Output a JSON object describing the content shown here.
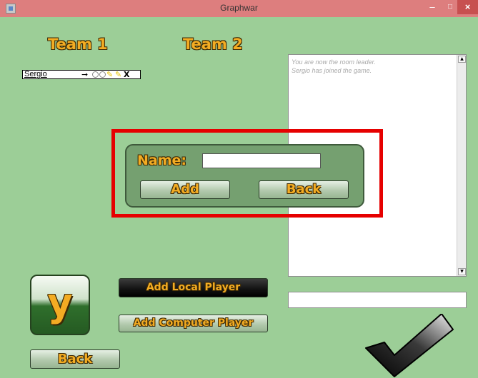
{
  "window": {
    "title": "Graphwar",
    "minimize_glyph": "–",
    "maximize_glyph": "□",
    "close_glyph": "×"
  },
  "teams": {
    "team1_label": "Team 1",
    "team2_label": "Team 2"
  },
  "players": [
    {
      "name": "Sergio",
      "arrow": "➞",
      "remove": "X"
    }
  ],
  "chat": {
    "messages": [
      "You are now the room leader.",
      "Sergio has joined the game."
    ],
    "input_value": ""
  },
  "name_dialog": {
    "label": "Name:",
    "input_value": "",
    "add_label": "Add",
    "back_label": "Back"
  },
  "buttons": {
    "add_local_player": "Add Local Player",
    "add_computer_player": "Add Computer Player",
    "back": "Back",
    "y_tile": "y"
  },
  "colors": {
    "background": "#9cce97",
    "titlebar": "#dd7e7e",
    "accent_text": "#f3ac23",
    "highlight": "#e60000"
  },
  "icons": [
    "app-icon",
    "minimize-icon",
    "maximize-icon",
    "close-icon",
    "arrow-icon",
    "checkmark-icon",
    "scroll-up-icon",
    "scroll-down-icon"
  ]
}
